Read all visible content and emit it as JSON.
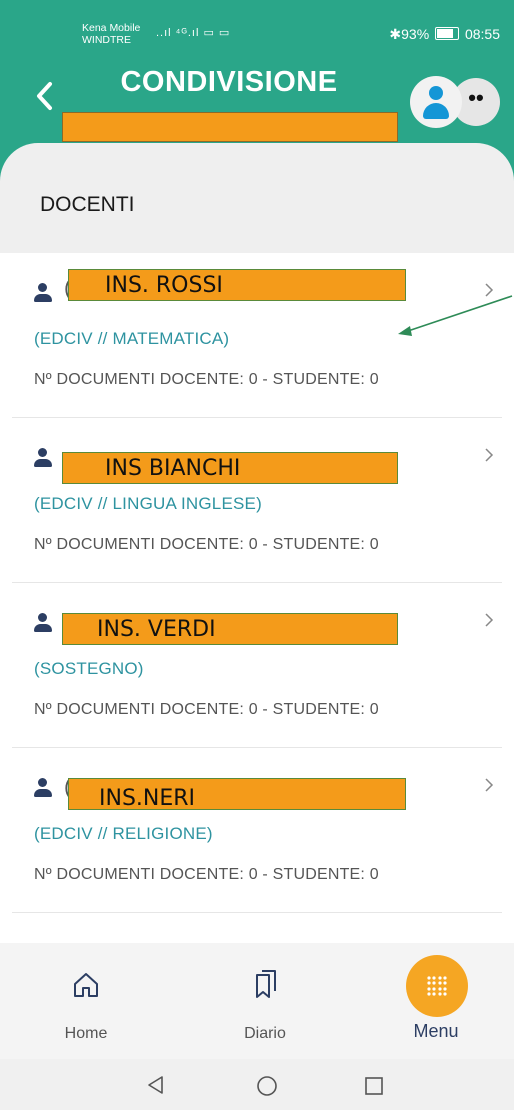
{
  "status_bar": {
    "carrier_line1": "Kena Mobile",
    "carrier_line2": "WINDTRE",
    "signal": "..ıl ⁴ᴳ.ıl ▭ ▭",
    "battery_percent": "93%",
    "time": "08:55"
  },
  "header": {
    "title": "CONDIVISIONE",
    "more_glyph": "••",
    "colors": {
      "header_bg": "#2aa689",
      "redaction": "#f49b1a"
    }
  },
  "section": {
    "title": "DOCENTI"
  },
  "teachers": [
    {
      "name": "INS. ROSSI",
      "subject": "(EDCIV // MATEMATICA)",
      "docs": "Nº DOCUMENTI DOCENTE: 0 - STUDENTE: 0"
    },
    {
      "name": "INS BIANCHI",
      "subject": "(EDCIV // LINGUA INGLESE)",
      "docs": "Nº DOCUMENTI DOCENTE: 0 - STUDENTE: 0"
    },
    {
      "name": "INS. VERDI",
      "subject": "(SOSTEGNO)",
      "docs": "Nº DOCUMENTI DOCENTE: 0 - STUDENTE: 0"
    },
    {
      "name": "INS.NERI",
      "subject": "(EDCIV // RELIGIONE)",
      "docs": "Nº DOCUMENTI DOCENTE: 0 - STUDENTE: 0"
    }
  ],
  "bottom_nav": {
    "home": "Home",
    "diario": "Diario",
    "menu": "Menu",
    "menu_color": "#f5a623"
  }
}
